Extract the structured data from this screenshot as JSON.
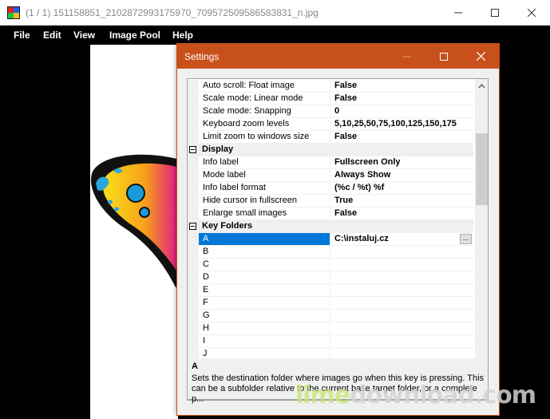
{
  "window": {
    "title": "(1 / 1) 151158851_2102872993175970_709572509586583831_n.jpg",
    "controls": {
      "minimize": "minimize-icon",
      "maximize": "maximize-icon",
      "close": "close-icon"
    }
  },
  "menu": [
    "File",
    "Edit",
    "View",
    "Image Pool",
    "Help"
  ],
  "settings": {
    "title": "Settings",
    "rows": [
      {
        "type": "prop",
        "name": "Auto scroll: Float image",
        "value": "False"
      },
      {
        "type": "prop",
        "name": "Scale mode: Linear mode",
        "value": "False"
      },
      {
        "type": "prop",
        "name": "Scale mode: Snapping",
        "value": "0"
      },
      {
        "type": "prop",
        "name": "Keyboard zoom levels",
        "value": "5,10,25,50,75,100,125,150,175"
      },
      {
        "type": "prop",
        "name": "Limit zoom to windows size",
        "value": "False"
      },
      {
        "type": "category",
        "name": "Display"
      },
      {
        "type": "prop",
        "name": "Info label",
        "value": "Fullscreen Only"
      },
      {
        "type": "prop",
        "name": "Mode label",
        "value": "Always Show"
      },
      {
        "type": "prop",
        "name": "Info label format",
        "value": "(%c / %t) %f"
      },
      {
        "type": "prop",
        "name": "Hide cursor in fullscreen",
        "value": "True"
      },
      {
        "type": "prop",
        "name": "Enlarge small images",
        "value": "False"
      },
      {
        "type": "category",
        "name": "Key Folders"
      },
      {
        "type": "prop",
        "name": "A",
        "value": "C:\\instaluj.cz",
        "selected": true,
        "button": "..."
      },
      {
        "type": "prop",
        "name": "B",
        "value": ""
      },
      {
        "type": "prop",
        "name": "C",
        "value": ""
      },
      {
        "type": "prop",
        "name": "D",
        "value": ""
      },
      {
        "type": "prop",
        "name": "E",
        "value": ""
      },
      {
        "type": "prop",
        "name": "F",
        "value": ""
      },
      {
        "type": "prop",
        "name": "G",
        "value": ""
      },
      {
        "type": "prop",
        "name": "H",
        "value": ""
      },
      {
        "type": "prop",
        "name": "I",
        "value": ""
      },
      {
        "type": "prop",
        "name": "J",
        "value": ""
      }
    ],
    "description": {
      "title": "A",
      "text": "Sets the destination folder where images go when this key is pressing. This can be a subfolder relative to the current base target folder, or a complete p..."
    }
  },
  "watermark": {
    "part1": "lime",
    "part2": "download.com"
  },
  "colors": {
    "dialog_title": "#c8501a",
    "selection": "#0078d7"
  }
}
